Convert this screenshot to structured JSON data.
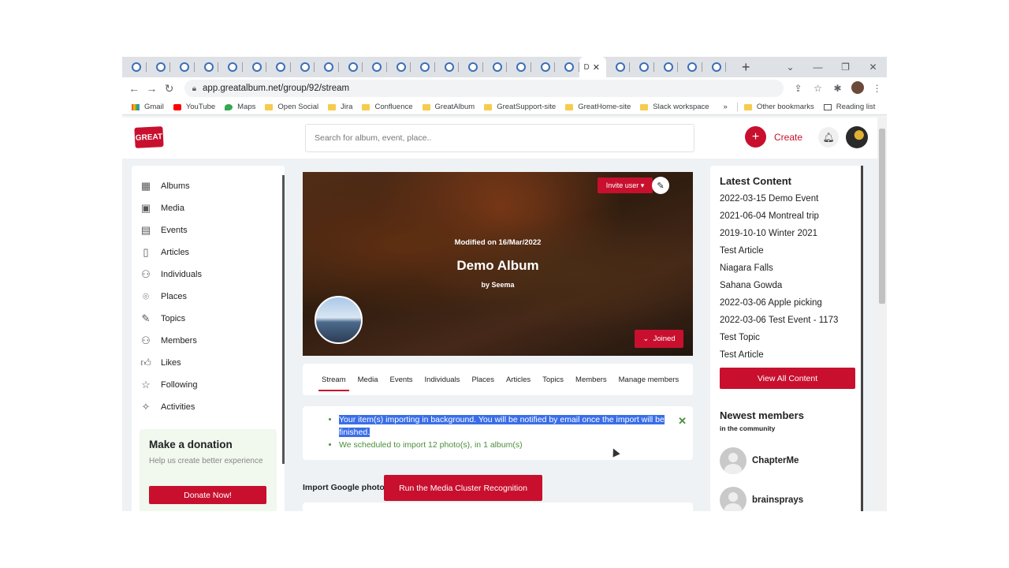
{
  "browser": {
    "url": "app.greatalbum.net/group/92/stream",
    "active_tab_glyph": "D",
    "bookmarks": [
      "Gmail",
      "YouTube",
      "Maps",
      "Open Social",
      "Jira",
      "Confluence",
      "GreatAlbum",
      "GreatSupport-site",
      "GreatHome-site",
      "Slack workspace"
    ],
    "bookmarks_more": "»",
    "other_bookmarks": "Other bookmarks",
    "reading_list": "Reading list"
  },
  "header": {
    "logo_text": "GREAT",
    "search_placeholder": "Search for album, event, place..",
    "create_label": "Create"
  },
  "sidebar": {
    "items": [
      {
        "label": "Albums",
        "icon": "grid-icon"
      },
      {
        "label": "Media",
        "icon": "image-icon"
      },
      {
        "label": "Events",
        "icon": "calendar-icon"
      },
      {
        "label": "Articles",
        "icon": "article-icon"
      },
      {
        "label": "Individuals",
        "icon": "person-icon"
      },
      {
        "label": "Places",
        "icon": "location-pin-icon"
      },
      {
        "label": "Topics",
        "icon": "pin-icon"
      },
      {
        "label": "Members",
        "icon": "person-icon"
      },
      {
        "label": "Likes",
        "icon": "thumbs-up-icon"
      },
      {
        "label": "Following",
        "icon": "star-icon"
      },
      {
        "label": "Activities",
        "icon": "wand-icon"
      }
    ],
    "donation": {
      "title": "Make a donation",
      "text": "Help us create better experience",
      "button": "Donate Now!"
    }
  },
  "album": {
    "invite_label": "Invite user",
    "modified": "Modified on 16/Mar/2022",
    "title": "Demo Album",
    "byline": "by Seema",
    "joined_label": "Joined"
  },
  "tabs": [
    "Stream",
    "Media",
    "Events",
    "Individuals",
    "Places",
    "Articles",
    "Topics",
    "Members",
    "Manage members"
  ],
  "notice": {
    "line1": "Your item(s) importing in background. You will be notified by email once the import will be finished.",
    "line2": "We scheduled to import 12 photo(s), in 1 album(s)"
  },
  "import": {
    "label": "Import Google photos",
    "button": "Run the Media Cluster Recognition"
  },
  "latest": {
    "title": "Latest Content",
    "items": [
      "2022-03-15 Demo Event",
      "2021-06-04 Montreal trip",
      "2019-10-10 Winter 2021",
      "Test Article",
      "Niagara Falls",
      "Sahana Gowda",
      "2022-03-06 Apple picking",
      "2022-03-06 Test Event - 1173",
      "Test Topic",
      "Test Article"
    ],
    "view_all": "View All Content"
  },
  "members": {
    "title": "Newest members",
    "subtitle": "in the community",
    "items": [
      "ChapterMe",
      "brainsprays"
    ]
  },
  "colors": {
    "accent": "#c8102e",
    "success": "#4a8f3a",
    "selection": "#3a6ee8"
  }
}
